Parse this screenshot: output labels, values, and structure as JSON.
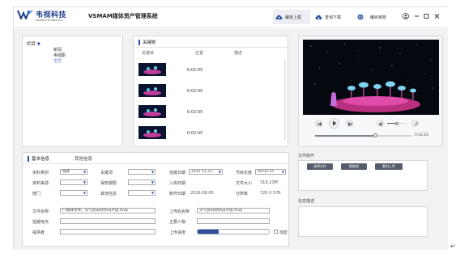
{
  "app": {
    "logo_cn": "韦视科技",
    "logo_en": "WEISEN TECHNOLOGY",
    "title": "VSMAM媒体资产管理系统"
  },
  "nav": [
    {
      "label": "编目上载",
      "icon": "cloud-upload-icon",
      "active": true
    },
    {
      "label": "查询下载",
      "icon": "cloud-download-icon",
      "active": false
    },
    {
      "label": "编目审核",
      "icon": "globe-icon",
      "active": false
    }
  ],
  "sidebar": {
    "title": "栏目",
    "items": [
      "新闻",
      "电视剧",
      "文艺"
    ],
    "selected": "文艺"
  },
  "keyframes": {
    "title": "关键帧",
    "columns": [
      "关键帧",
      "位置",
      "描述"
    ],
    "rows": [
      {
        "time": "0:02:05",
        "desc": ""
      },
      {
        "time": "0:02:05",
        "desc": ""
      },
      {
        "time": "0:02:05",
        "desc": ""
      },
      {
        "time": "0:02:05",
        "desc": ""
      }
    ]
  },
  "player": {
    "time": "0:02:05",
    "progress": 0.62,
    "volume": 0.5
  },
  "tabs": [
    "基本信息",
    "其他信息"
  ],
  "form": {
    "category": {
      "label": "资料类别",
      "value": "视频"
    },
    "keyword": {
      "label": "关键词",
      "value": ""
    },
    "shoot_date": {
      "label": "拍摄日期",
      "value": "2015.12.23"
    },
    "duration": {
      "label": "节目长度",
      "value": "00:02:35"
    },
    "source": {
      "label": "资料来源",
      "value": ""
    },
    "secrecy": {
      "label": "保管期限",
      "value": ""
    },
    "store_date": {
      "label": "入库日期",
      "value": ""
    },
    "file_size": {
      "label": "文件大小",
      "value": "319.23M"
    },
    "dept": {
      "label": "部门",
      "value": ""
    },
    "other": {
      "label": "其他信息",
      "value": ""
    },
    "make_date": {
      "label": "制作日期",
      "value": "2016.08.05"
    },
    "resolution": {
      "label": "分辨率",
      "value": "720 X 576"
    },
    "file_name": {
      "label": "文件名称",
      "value": "F:\\媒体文件。天气资讯8月6日片段.m2p"
    },
    "upload_name": {
      "label": "上传后名称",
      "value": "天气资讯8月6日片段.m2p"
    },
    "location": {
      "label": "拍摄地点",
      "value": ""
    },
    "persons": {
      "label": "主要人物",
      "value": ""
    },
    "provider": {
      "label": "提供者",
      "value": ""
    },
    "upload_progress": {
      "label": "上传进度",
      "value": 0.3
    },
    "encrypt": {
      "label": "加密"
    }
  },
  "file_ops": {
    "title": "文件操作",
    "buttons": [
      "选择文件",
      "提取帧",
      "素材上传"
    ]
  },
  "info_desc": {
    "title": "信息描述"
  }
}
